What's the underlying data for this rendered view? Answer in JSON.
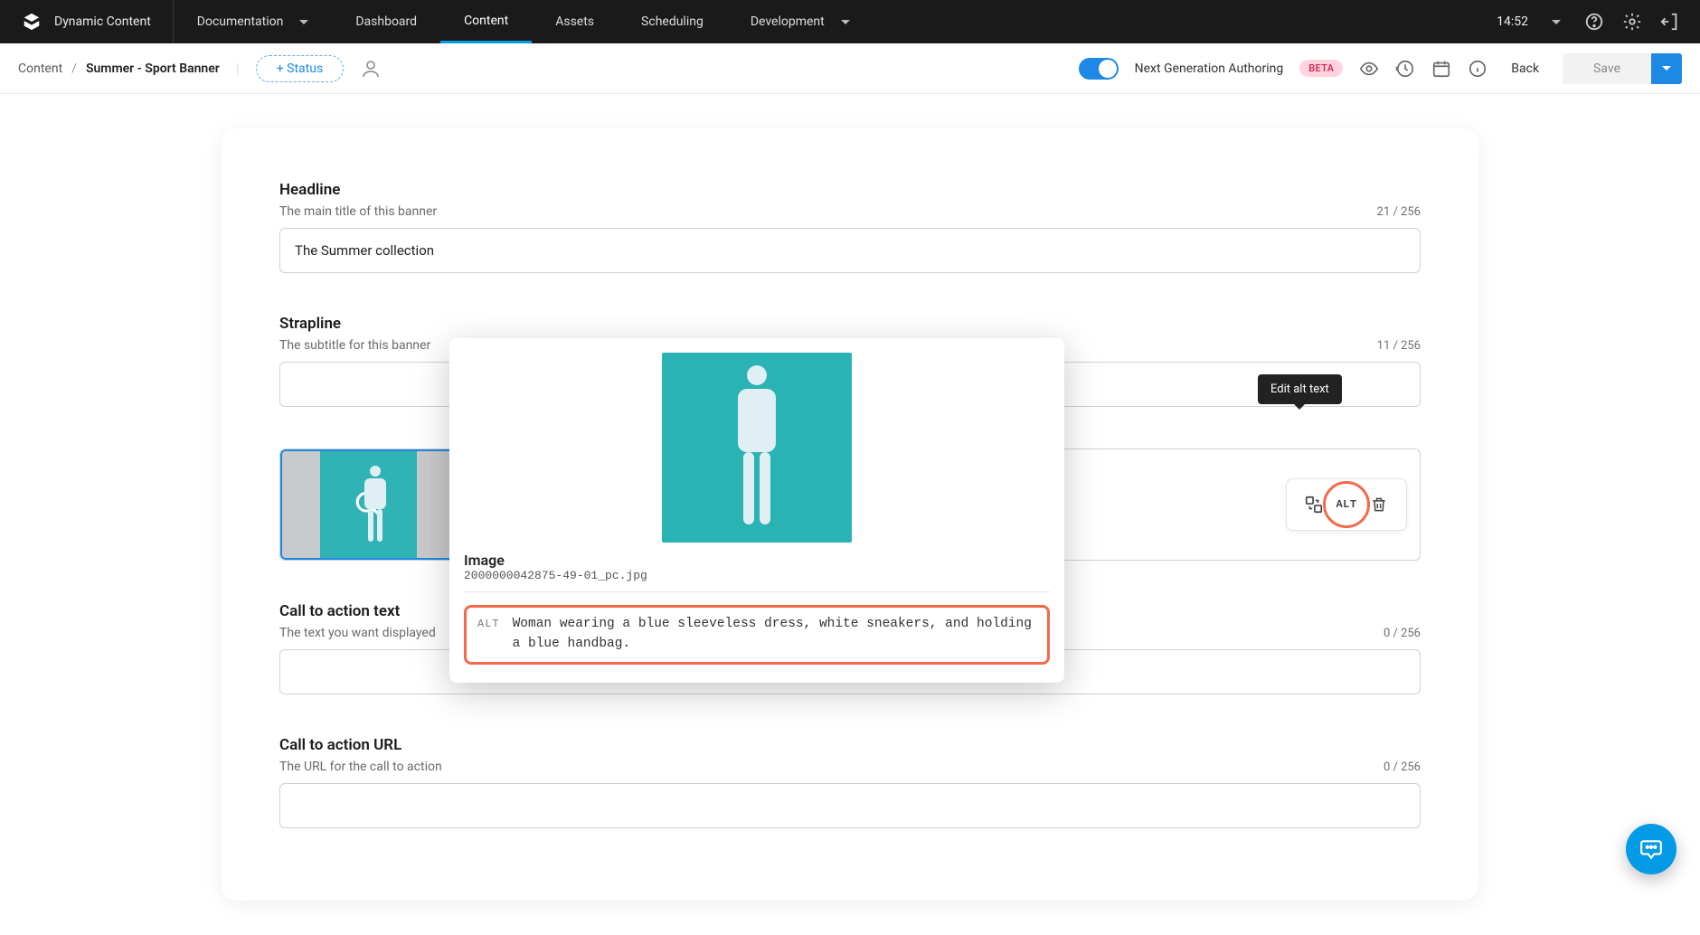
{
  "brand": "Dynamic Content",
  "nav": {
    "documentation": "Documentation",
    "dashboard": "Dashboard",
    "content": "Content",
    "assets": "Assets",
    "scheduling": "Scheduling",
    "development": "Development"
  },
  "time": "14:52",
  "crumbs": {
    "root": "Content",
    "sep": "/",
    "current": "Summer - Sport Banner"
  },
  "status_btn": "+ Status",
  "nga": {
    "label": "Next Generation Authoring",
    "badge": "BETA"
  },
  "actions": {
    "back": "Back",
    "save": "Save"
  },
  "fields": {
    "headline": {
      "label": "Headline",
      "help": "The main title of this banner",
      "count": "21 / 256",
      "value": "The Summer collection"
    },
    "strapline": {
      "label": "Strapline",
      "help": "The subtitle for this banner",
      "count": "11 / 256",
      "value": ""
    },
    "cta_text": {
      "label": "Call to action text",
      "help": "The text you want displayed",
      "count": "0 / 256",
      "value": ""
    },
    "cta_url": {
      "label": "Call to action URL",
      "help": "The URL for the call to action",
      "count": "0 / 256",
      "value": ""
    }
  },
  "img_tools": {
    "alt": "ALT"
  },
  "tooltip": "Edit alt text",
  "popover": {
    "title": "Image",
    "file": "2000000042875-49-01_pc.jpg",
    "alt_tag": "ALT",
    "alt_text": "Woman wearing a blue sleeveless dress, white sneakers, and holding a blue handbag."
  }
}
